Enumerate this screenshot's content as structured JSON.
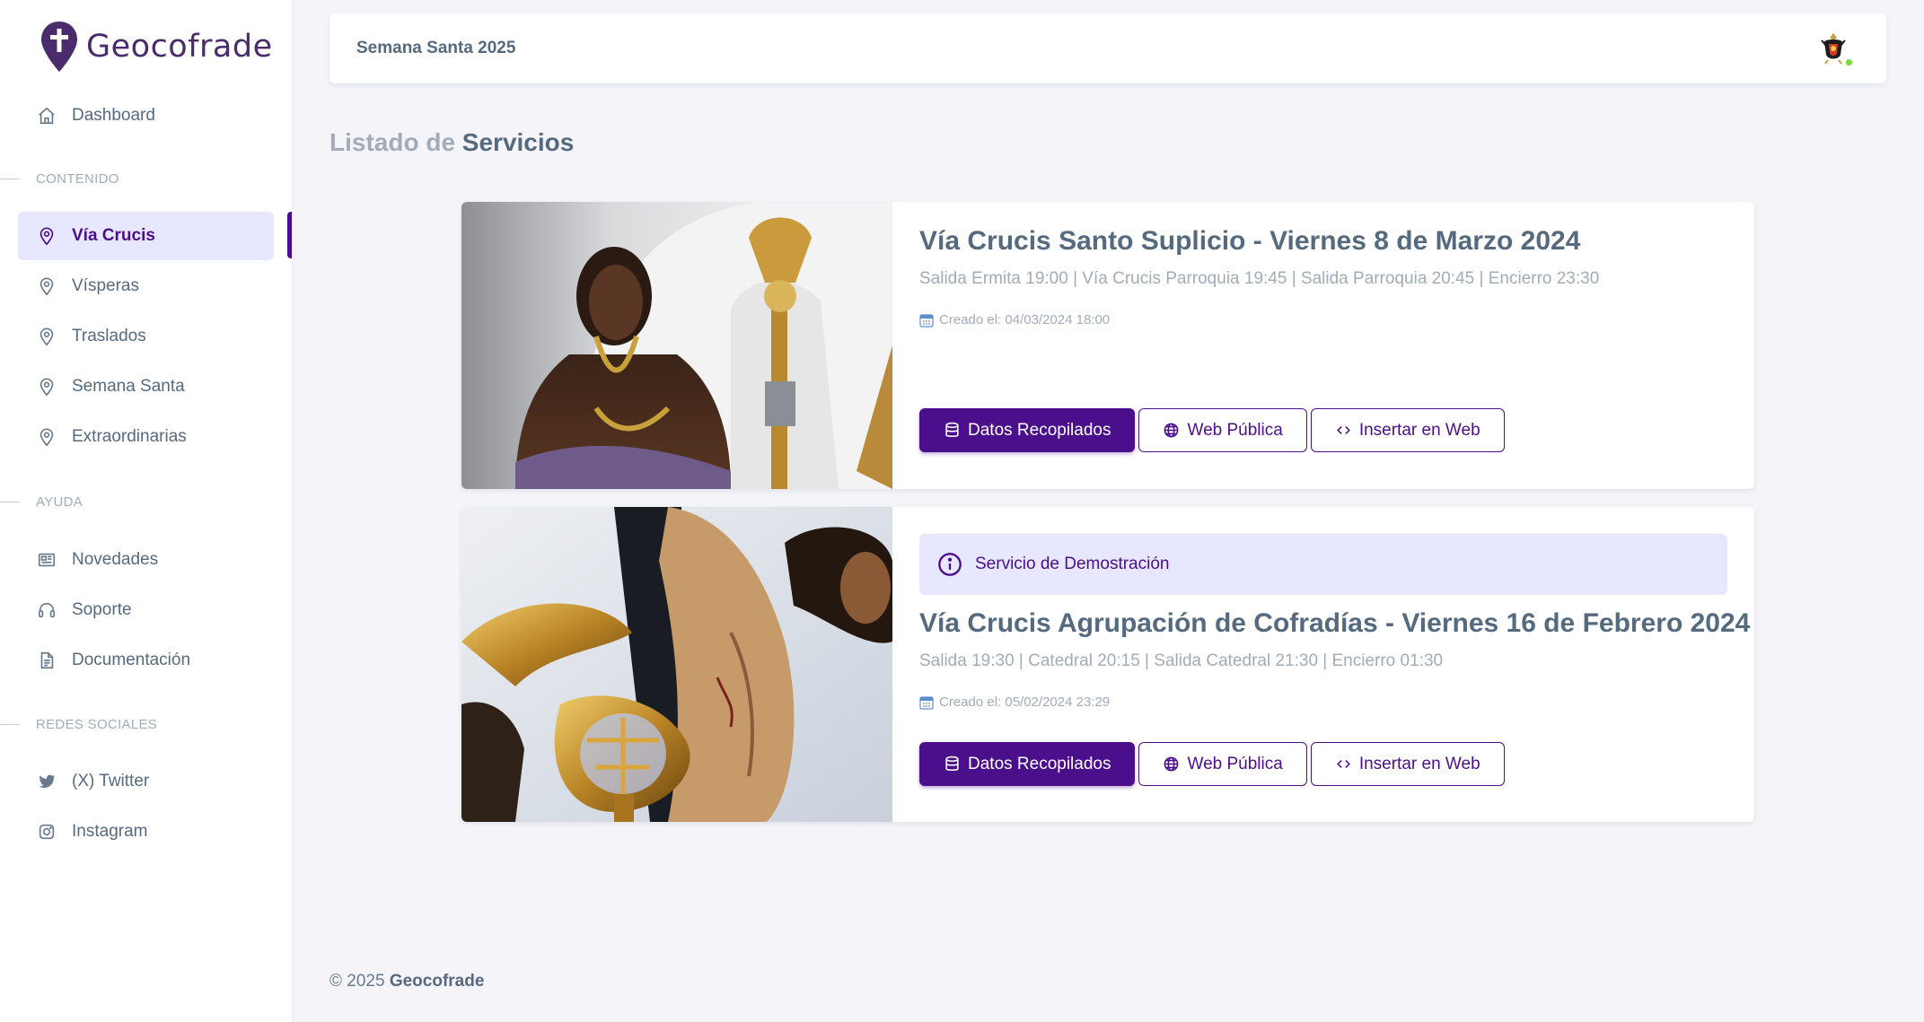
{
  "brand": {
    "name": "Geocofrade"
  },
  "sidebar": {
    "dashboard": "Dashboard",
    "sections": [
      {
        "header": "CONTENIDO"
      },
      {
        "header": "AYUDA"
      },
      {
        "header": "REDES SOCIALES"
      }
    ],
    "content_items": [
      "Vía Crucis",
      "Vísperas",
      "Traslados",
      "Semana Santa",
      "Extraordinarias"
    ],
    "help_items": [
      "Novedades",
      "Soporte",
      "Documentación"
    ],
    "social_items": [
      "(X) Twitter",
      "Instagram"
    ],
    "active_item": "Vía Crucis"
  },
  "navbar": {
    "title": "Semana Santa 2025"
  },
  "page": {
    "title_prefix": "Listado de",
    "title_strong": "Servicios"
  },
  "services": [
    {
      "title": "Vía Crucis Santo Suplicio - Viernes 8 de Marzo 2024",
      "description": "Salida Ermita 19:00 | Vía Crucis Parroquia 19:45 | Salida Parroquia 20:45 | Encierro 23:30",
      "created": "Creado el: 04/03/2024 18:00",
      "alert": null
    },
    {
      "title": "Vía Crucis Agrupación de Cofradías - Viernes 16 de Febrero 2024",
      "description": "Salida 19:30 | Catedral 20:15 | Salida Catedral 21:30 | Encierro 01:30",
      "created": "Creado el: 05/02/2024 23:29",
      "alert": "Servicio de Demostración"
    }
  ],
  "buttons": {
    "data": "Datos Recopilados",
    "web": "Web Pública",
    "embed": "Insertar en Web"
  },
  "footer": {
    "copyright": "© 2025",
    "brand": "Geocofrade"
  },
  "colors": {
    "primary": "#4b0f8c",
    "active_bg": "#e7e7ff",
    "text": "#566a7f",
    "muted": "#a1acb8",
    "online": "#71dd37"
  }
}
